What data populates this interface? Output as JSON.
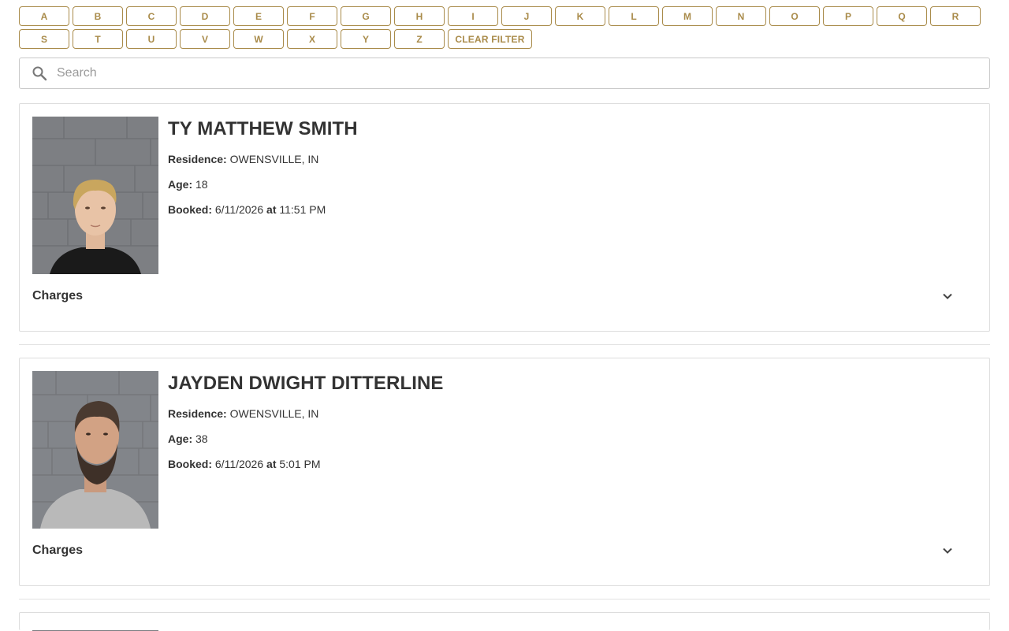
{
  "filter": {
    "letters": [
      "A",
      "B",
      "C",
      "D",
      "E",
      "F",
      "G",
      "H",
      "I",
      "J",
      "K",
      "L",
      "M",
      "N",
      "O",
      "P",
      "Q",
      "R",
      "S",
      "T",
      "U",
      "V",
      "W",
      "X",
      "Y",
      "Z"
    ],
    "clear_label": "CLEAR FILTER"
  },
  "search": {
    "placeholder": "Search",
    "value": ""
  },
  "labels": {
    "residence": "Residence:",
    "age": "Age:",
    "booked": "Booked:",
    "at": "at",
    "charges": "Charges"
  },
  "inmates": [
    {
      "name": "TY MATTHEW SMITH",
      "residence": "OWENSVILLE, IN",
      "age": "18",
      "booked_date": "6/11/2026",
      "booked_time": "11:51 PM"
    },
    {
      "name": "JAYDEN DWIGHT DITTERLINE",
      "residence": "OWENSVILLE, IN",
      "age": "38",
      "booked_date": "6/11/2026",
      "booked_time": "5:01 PM"
    }
  ],
  "colors": {
    "accent": "#a98b4a",
    "text": "#333333",
    "border": "#dddddd"
  }
}
